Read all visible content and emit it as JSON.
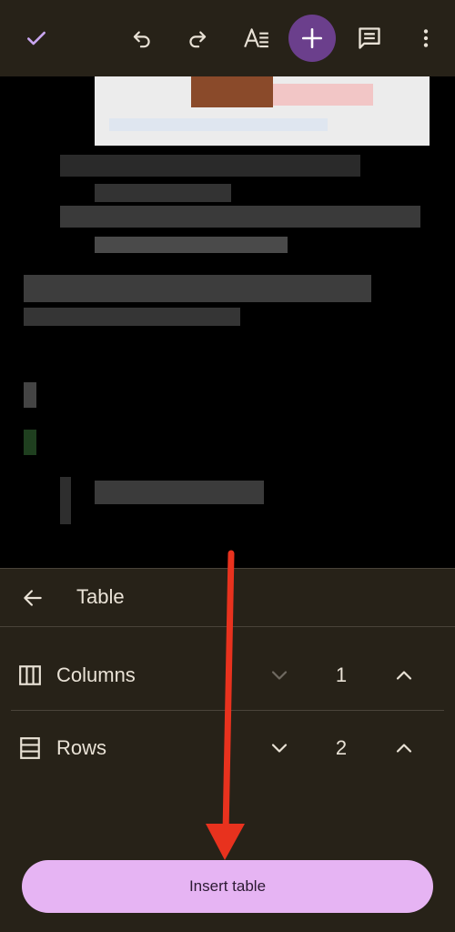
{
  "toolbar": {
    "buttons": [
      {
        "name": "done-check-icon",
        "color": "#c9a6f0"
      },
      {
        "name": "undo-icon"
      },
      {
        "name": "redo-icon"
      },
      {
        "name": "text-format-icon"
      },
      {
        "name": "insert-plus-icon",
        "background": "#6b3f8c"
      },
      {
        "name": "comment-icon"
      },
      {
        "name": "more-vert-icon"
      }
    ]
  },
  "sheet": {
    "title": "Table",
    "back_icon": "arrow-back-icon",
    "columns": {
      "label": "Columns",
      "value": "1",
      "icon": "columns-icon",
      "decrement_disabled": true
    },
    "rows": {
      "label": "Rows",
      "value": "2",
      "icon": "rows-icon",
      "decrement_disabled": false
    },
    "insert_label": "Insert table"
  },
  "colors": {
    "toolbar_bg": "#272218",
    "sheet_bg": "#272218",
    "primary_button": "#e6b4f3",
    "annotation_arrow": "#e8321e"
  }
}
